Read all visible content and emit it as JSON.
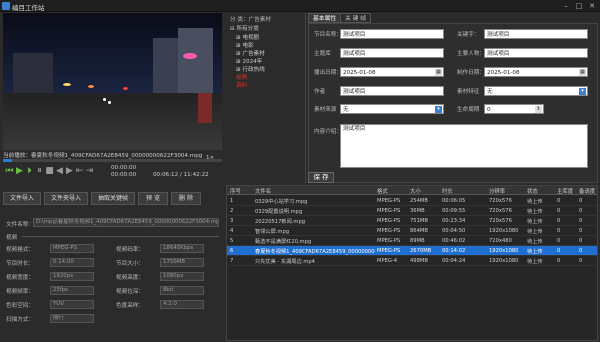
{
  "window": {
    "title": "编目工作站"
  },
  "player": {
    "now_playing_label": "当前播放：",
    "now_playing_file": "春夏秋冬视频1_409CFAD67A2E8459_00000000622F3004.mpg",
    "progress_fraction": 0.04,
    "speed": "1×",
    "time_start": "00:00:00",
    "time_in": "00:00:00",
    "time_current": "00:06:12",
    "time_total": "11:42:22"
  },
  "buttons": {
    "file_import": "文件导入",
    "folder_import": "文件夹导入",
    "extract_keyframe": "抽取关键帧",
    "preview": "预 览",
    "delete": "删 除",
    "save": "保 存"
  },
  "file_info": {
    "path_label": "文件名称：",
    "path_value": "D:\\mpg\\春夏秋冬视频1_409CFAD67A2E8459_00000000622F3004.mpg",
    "section_label": "视频",
    "fields": [
      {
        "label": "视频格式：",
        "value": "MPEG-PS"
      },
      {
        "label": "视频码率：",
        "value": "18645Kbps"
      },
      {
        "label": "节目时长：",
        "value": "0:14:00"
      },
      {
        "label": "节目大小：",
        "value": "1750MB"
      },
      {
        "label": "视频宽度：",
        "value": "1920px"
      },
      {
        "label": "视频高度：",
        "value": "1080px"
      },
      {
        "label": "视频帧率：",
        "value": "25fps"
      },
      {
        "label": "视频位深：",
        "value": "8bit"
      },
      {
        "label": "色彩空间：",
        "value": "YUV"
      },
      {
        "label": "色度采样：",
        "value": "4:2:0"
      },
      {
        "label": "扫描方式：",
        "value": "隔行"
      }
    ]
  },
  "tree": {
    "header": "分 类：广告素材",
    "root": "所有分类",
    "items": [
      {
        "label": "电视剧",
        "red": false
      },
      {
        "label": "电影",
        "red": false
      },
      {
        "label": "广告素材",
        "red": false
      },
      {
        "label": "2024年",
        "red": false
      },
      {
        "label": "行政热线",
        "red": false
      },
      {
        "label": "经费",
        "red": true
      },
      {
        "label": "资料",
        "red": true
      }
    ]
  },
  "props": {
    "tabs": [
      "基本属性",
      "关 键 帧"
    ],
    "fields": {
      "program_name": {
        "label": "节目名称：",
        "value": "测试项目"
      },
      "keyword": {
        "label": "关键字：",
        "value": "测试项目"
      },
      "host": {
        "label": "主题库",
        "value": "测试项目"
      },
      "person": {
        "label": "主要人物：",
        "value": "测试项目"
      },
      "air_date": {
        "label": "播出日期：",
        "value": "2025-01-08"
      },
      "make_date": {
        "label": "制作日期：",
        "value": "2025-01-08"
      },
      "author": {
        "label": "作者",
        "value": "测试项目"
      },
      "material_feature": {
        "label": "素材特征",
        "value": "无"
      },
      "material_source": {
        "label": "素材来源",
        "value": "无"
      },
      "life_cycle": {
        "label": "生命周期",
        "value": "0"
      },
      "content": {
        "label": "内容介绍：",
        "value": "测试项目"
      }
    }
  },
  "table": {
    "headers": [
      "序号",
      "文件名",
      "格式",
      "大小",
      "时长",
      "分辨率",
      "状态",
      "主库度",
      "备请度"
    ],
    "rows": [
      [
        "1",
        "0329中心站学习.mpg",
        "MPEG-PS",
        "254MB",
        "00:06:05",
        "720x576",
        "待上传",
        "0",
        "0"
      ],
      [
        "2",
        "0329配置说明.mpg",
        "MPEG-PS",
        "36MB",
        "00:09:55",
        "720x576",
        "待上传",
        "0",
        "0"
      ],
      [
        "3",
        "20220517新闻.mpg",
        "MPEG-PS",
        "751MB",
        "00:23:34",
        "720x576",
        "待上传",
        "0",
        "0"
      ],
      [
        "4",
        "智领公屏.mpg",
        "MPEG-PS",
        "864MB",
        "00:04:50",
        "1920x1080",
        "待上传",
        "0",
        "0"
      ],
      [
        "5",
        "甄选不是满屏红20.mpg",
        "MPEG-PS",
        "89MB",
        "00:46:02",
        "720x480",
        "待上传",
        "0",
        "0"
      ],
      [
        "6",
        "春夏秋冬视频1_409CFAD67A2E8459_000000006...",
        "MPEG-PS",
        "2670MB",
        "00:14:02",
        "1920x1080",
        "待上传",
        "0",
        "0"
      ],
      [
        "7",
        "只先优美 - 东湖周边.mp4",
        "MPEG-4",
        "498MB",
        "00:04:24",
        "1920x1080",
        "待上传",
        "0",
        "0"
      ]
    ],
    "selected_index": 5
  },
  "colors": {
    "accent": "#1f6fd0",
    "play_green": "#6cc04a",
    "tree_red": "#e03030"
  }
}
